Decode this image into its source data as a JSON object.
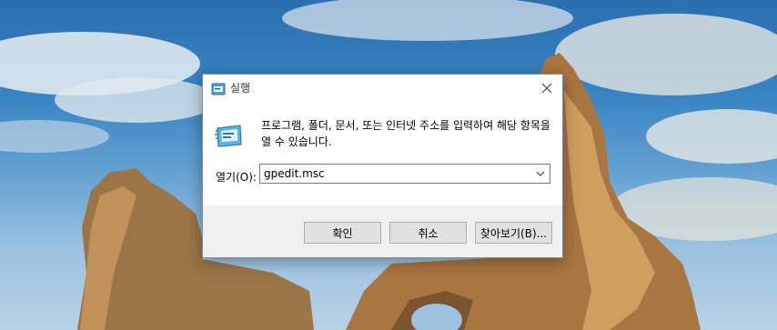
{
  "dialog": {
    "title": "실행",
    "description": "프로그램, 폴더, 문서, 또는 인터넷 주소를 입력하여 해당 항목을 열 수 있습니다.",
    "open_label": "열기(O):",
    "open_value": "gpedit.msc",
    "buttons": {
      "ok": "확인",
      "cancel": "취소",
      "browse": "찾아보기(B)..."
    }
  },
  "colors": {
    "sky": "#3a85c4",
    "rock": "#b07a3e",
    "dialog_bg": "#ffffff",
    "footer_bg": "#f0f0f0"
  },
  "icons": {
    "title": "run-icon",
    "close": "close-icon",
    "dropdown": "chevron-down-icon"
  }
}
